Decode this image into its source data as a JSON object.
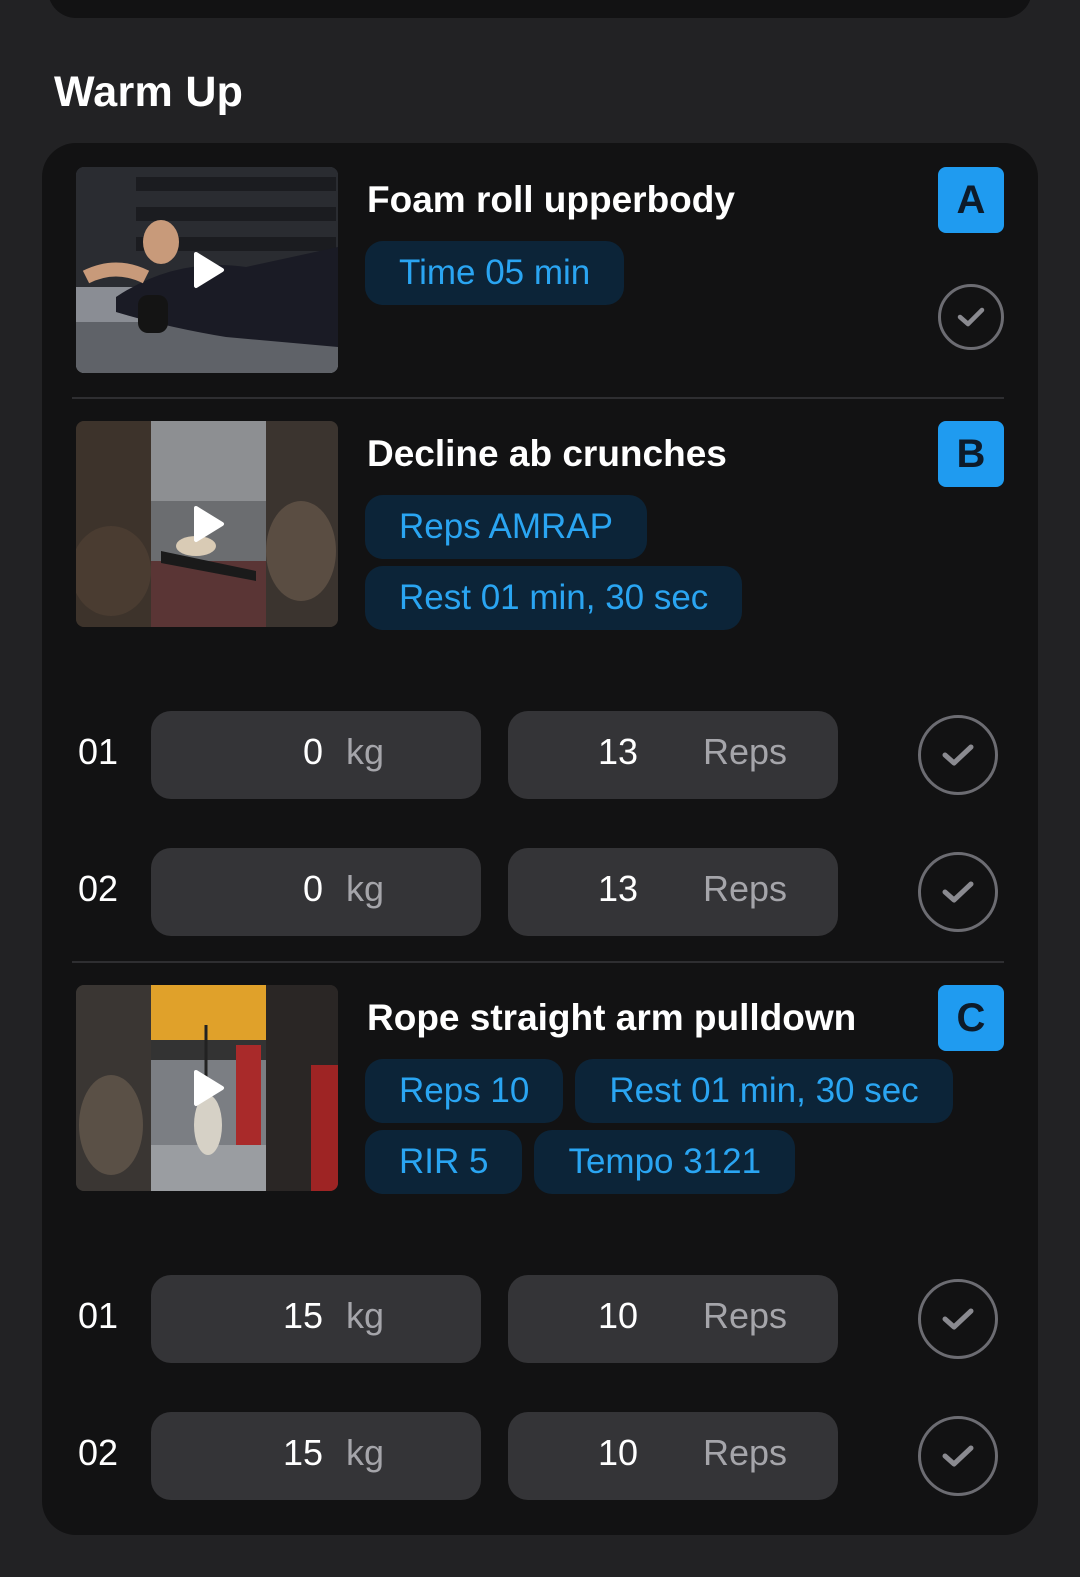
{
  "section": {
    "title": "Warm Up"
  },
  "exercises": [
    {
      "letter": "A",
      "name": "Foam roll upperbody",
      "chips": [
        [
          "Time 05 min"
        ]
      ],
      "thumbnail_icon": "play-icon",
      "sets": []
    },
    {
      "letter": "B",
      "name": "Decline ab crunches",
      "chips": [
        [
          "Reps AMRAP"
        ],
        [
          "Rest 01 min, 30 sec"
        ]
      ],
      "thumbnail_icon": "play-icon",
      "sets": [
        {
          "num": "01",
          "weight": "0",
          "weight_unit": "kg",
          "reps": "13",
          "reps_unit": "Reps"
        },
        {
          "num": "02",
          "weight": "0",
          "weight_unit": "kg",
          "reps": "13",
          "reps_unit": "Reps"
        }
      ]
    },
    {
      "letter": "C",
      "name": "Rope straight arm pulldown",
      "chips": [
        [
          "Reps 10",
          "Rest 01 min, 30 sec"
        ],
        [
          "RIR 5",
          "Tempo 3121"
        ]
      ],
      "thumbnail_icon": "play-icon",
      "sets": [
        {
          "num": "01",
          "weight": "15",
          "weight_unit": "kg",
          "reps": "10",
          "reps_unit": "Reps"
        },
        {
          "num": "02",
          "weight": "15",
          "weight_unit": "kg",
          "reps": "10",
          "reps_unit": "Reps"
        }
      ]
    }
  ],
  "colors": {
    "background": "#222224",
    "card": "#121213",
    "accent": "#1f9bf0",
    "chip_bg": "#0c2438",
    "chip_text": "#2aa5f2",
    "field_bg": "#343437"
  }
}
